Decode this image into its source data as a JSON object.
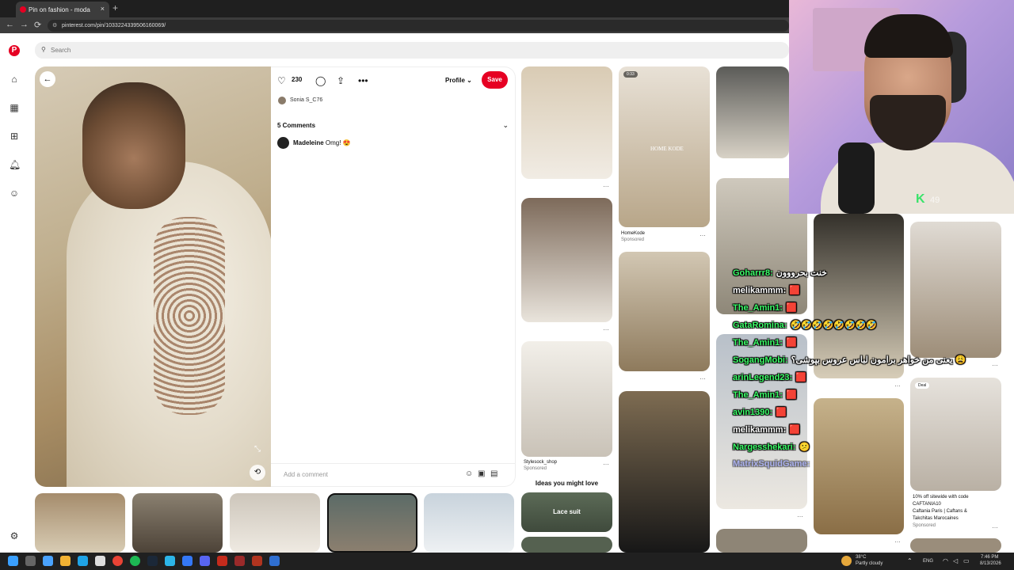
{
  "browser": {
    "tab_title": "Pin on fashion - moda",
    "tab_close": "×",
    "new_tab": "+",
    "url": "pinterest.com/pin/1033224339506160069/",
    "back": "←",
    "forward": "→",
    "reload": "⟳"
  },
  "search": {
    "placeholder": "Search"
  },
  "pin": {
    "likes": "230",
    "profile_label": "Profile",
    "save_label": "Save",
    "user": "Sonia S_C76",
    "comments_title": "5 Comments",
    "comment_author": "Madeleine",
    "comment_text": "Omg! 😍",
    "add_comment_placeholder": "Add a comment"
  },
  "grid": {
    "c1": {
      "cap": "Stylesock_shop",
      "sponsored": "Sponsored",
      "ideas": "Ideas you might love",
      "lace_suit": "Lace suit"
    },
    "c2": {
      "video_time": "0:33",
      "cap": "HomeKode",
      "sponsored": "Sponsored",
      "home": "HOME KODE"
    },
    "c5": {
      "deal": "Deal",
      "cap1": "10% off sitewide with code",
      "cap2": "CAFTANIA10",
      "cap3": "Caftania Paris | Caftans &",
      "cap4": "Takchitas Marocaines",
      "sponsored": "Sponsored"
    }
  },
  "stream": {
    "kick_count": "49",
    "chat": [
      {
        "name": "Goharrr8:",
        "msg": "خنت بحرووون",
        "color": "#3cff6a"
      },
      {
        "name": "melikammm:",
        "msg": "🟥",
        "color": "#ffffff"
      },
      {
        "name": "The_Amin1:",
        "msg": "🟥",
        "color": "#3cff6a"
      },
      {
        "name": "GataRomina:",
        "msg": "🤣🤣🤣🤣🤣🤣🤣🤣",
        "color": "#3cff6a"
      },
      {
        "name": "The_Amin1:",
        "msg": "🟥",
        "color": "#3cff6a"
      },
      {
        "name": "SogangMobi:",
        "msg": "یعنی من خواهر برامون لباس عروس بپوشی؟ 😩",
        "color": "#3cff6a"
      },
      {
        "name": "arinLegend23:",
        "msg": "🟥",
        "color": "#3cff6a"
      },
      {
        "name": "The_Amin1:",
        "msg": "🟥",
        "color": "#3cff6a"
      },
      {
        "name": "avin1390:",
        "msg": "🟥",
        "color": "#3cff6a"
      },
      {
        "name": "melikammm:",
        "msg": "🟥",
        "color": "#ffffff"
      },
      {
        "name": "Nargesshekari:",
        "msg": "😕",
        "color": "#3cff6a"
      },
      {
        "name": "MatrixSquidGame:",
        "msg": "",
        "color": "#7f8cff"
      }
    ]
  },
  "taskbar": {
    "weather_temp": "38°C",
    "weather_desc": "Partly cloudy",
    "lang": "ENG",
    "time": "7:46 PM",
    "date": "8/13/2026"
  },
  "colors": {
    "brand": "#e60023"
  }
}
